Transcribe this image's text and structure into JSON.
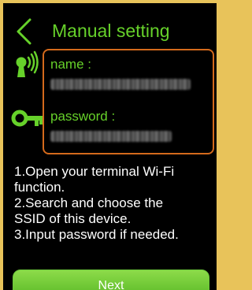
{
  "header": {
    "title": "Manual setting"
  },
  "credentials": {
    "name_label": "name :",
    "name_value": "",
    "password_label": "password :",
    "password_value": ""
  },
  "instructions": [
    "1.Open your terminal Wi-Fi",
    "function.",
    "2.Search and choose the",
    "SSID of this device.",
    "3.Input password if needed."
  ],
  "actions": {
    "next_label": "Next"
  },
  "colors": {
    "accent": "#66d12a",
    "border": "#d46a1c",
    "frame": "#e8c35a",
    "background": "#000000"
  },
  "icons": {
    "back": "chevron-left-icon",
    "wifi": "wifi-signal-icon",
    "key": "key-icon"
  }
}
